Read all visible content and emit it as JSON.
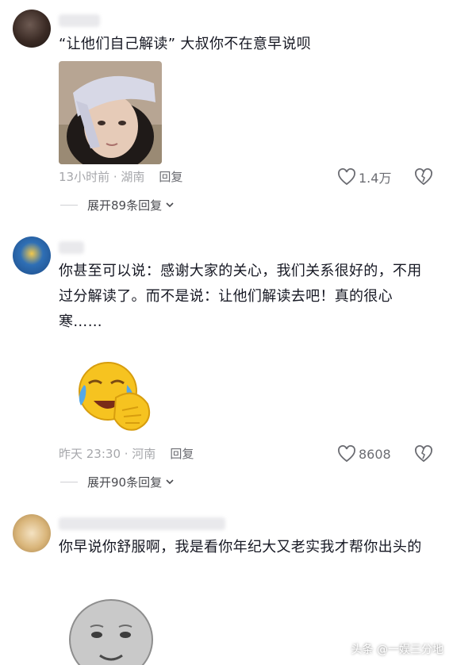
{
  "comments": [
    {
      "text": "“让他们自己解读” 大叔你不在意早说呗",
      "meta": "13小时前 · 湖南",
      "reply_label": "回复",
      "likes": "1.4万",
      "expand_label": "展开89条回复"
    },
    {
      "text": "你甚至可以说：感谢大家的关心，我们关系很好的，不用过分解读了。而不是说：让他们解读去吧！真的很心寒……",
      "meta": "昨天 23:30 · 河南",
      "reply_label": "回复",
      "likes": "8608",
      "expand_label": "展开90条回复"
    },
    {
      "text": "你早说你舒服啊，我是看你年纪大又老实我才帮你出头的"
    }
  ],
  "watermark": "头条 @一娱三分地",
  "colors": {
    "text": "#161823",
    "meta": "#a6a7ab",
    "icon": "#6b6c72"
  }
}
